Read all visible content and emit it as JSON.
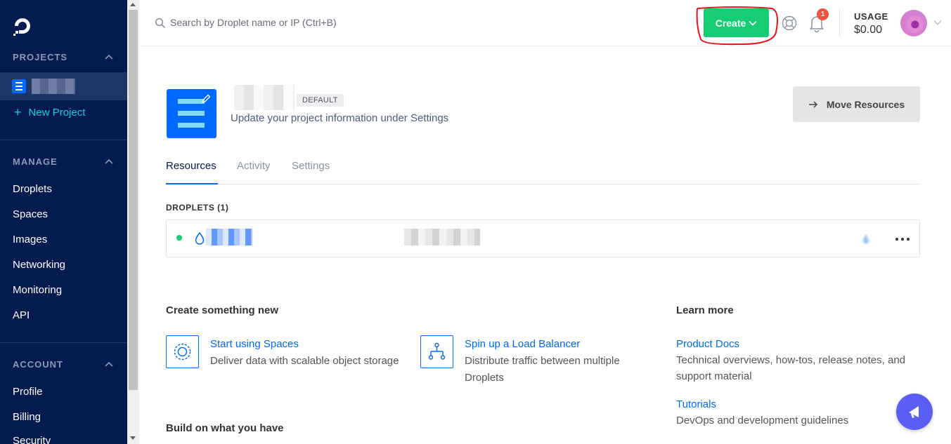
{
  "sidebar": {
    "projects_heading": "PROJECTS",
    "new_project": "New Project",
    "manage_heading": "MANAGE",
    "manage_items": [
      "Droplets",
      "Spaces",
      "Images",
      "Networking",
      "Monitoring",
      "API"
    ],
    "account_heading": "ACCOUNT",
    "account_items": [
      "Profile",
      "Billing",
      "Security"
    ]
  },
  "topbar": {
    "search_placeholder": "Search by Droplet name or IP (Ctrl+B)",
    "create_label": "Create",
    "notification_count": "1",
    "usage_label": "USAGE",
    "usage_value": "$0.00"
  },
  "project": {
    "badge": "DEFAULT",
    "subtitle": "Update your project information under Settings",
    "move_button": "Move Resources",
    "tabs": [
      "Resources",
      "Activity",
      "Settings"
    ],
    "droplets_heading": "DROPLETS (1)"
  },
  "create_section": {
    "heading": "Create something new",
    "cards": [
      {
        "title": "Start using Spaces",
        "desc": "Deliver data with scalable object storage"
      },
      {
        "title": "Spin up a Load Balancer",
        "desc": "Distribute traffic between multiple Droplets"
      }
    ]
  },
  "learn_section": {
    "heading": "Learn more",
    "links": [
      {
        "title": "Product Docs",
        "desc": "Technical overviews, how-tos, release notes, and support material"
      },
      {
        "title": "Tutorials",
        "desc": "DevOps and development guidelines"
      }
    ]
  },
  "build_section": {
    "heading": "Build on what you have"
  },
  "colors": {
    "sidebar_bg": "#031b4e",
    "accent_blue": "#0069ff",
    "create_green": "#15cd72",
    "highlight_red": "#e8141c",
    "fab_purple": "#5b5ef5"
  }
}
